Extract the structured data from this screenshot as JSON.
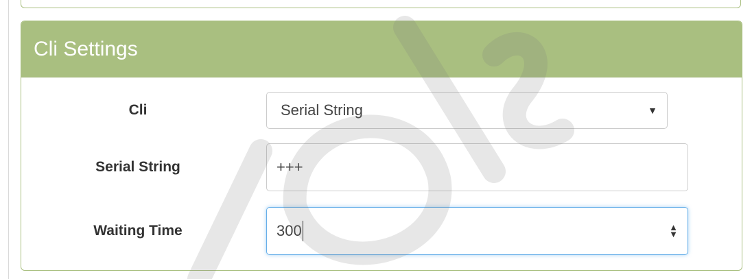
{
  "panel": {
    "title": "Cli Settings"
  },
  "fields": {
    "cli": {
      "label": "Cli",
      "selected": "Serial String"
    },
    "serial_string": {
      "label": "Serial String",
      "value": "+++"
    },
    "waiting_time": {
      "label": "Waiting Time",
      "value": "300"
    }
  },
  "colors": {
    "panel_heading": "#a9bf80",
    "focus_border": "#66afe9"
  },
  "icons": {
    "select_arrow": "triangle-down-icon",
    "spinner": "up-down-spinner-icon"
  }
}
